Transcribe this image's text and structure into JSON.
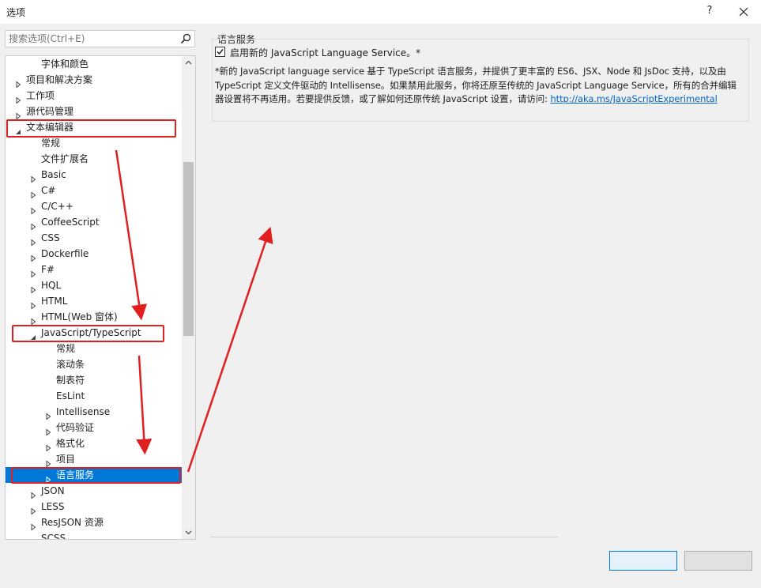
{
  "window": {
    "title": "选项",
    "help_label": "?"
  },
  "search": {
    "placeholder": "搜索选项(Ctrl+E)"
  },
  "tree": {
    "items": [
      {
        "label": "字体和颜色",
        "level": 2,
        "expander": "none"
      },
      {
        "label": "项目和解决方案",
        "level": 1,
        "expander": "collapsed"
      },
      {
        "label": "工作项",
        "level": 1,
        "expander": "collapsed"
      },
      {
        "label": "源代码管理",
        "level": 1,
        "expander": "collapsed"
      },
      {
        "label": "文本编辑器",
        "level": 1,
        "expander": "expanded"
      },
      {
        "label": "常规",
        "level": 2,
        "expander": "none"
      },
      {
        "label": "文件扩展名",
        "level": 2,
        "expander": "none"
      },
      {
        "label": "Basic",
        "level": 2,
        "expander": "collapsed"
      },
      {
        "label": "C#",
        "level": 2,
        "expander": "collapsed"
      },
      {
        "label": "C/C++",
        "level": 2,
        "expander": "collapsed"
      },
      {
        "label": "CoffeeScript",
        "level": 2,
        "expander": "collapsed"
      },
      {
        "label": "CSS",
        "level": 2,
        "expander": "collapsed"
      },
      {
        "label": "Dockerfile",
        "level": 2,
        "expander": "collapsed"
      },
      {
        "label": "F#",
        "level": 2,
        "expander": "collapsed"
      },
      {
        "label": "HQL",
        "level": 2,
        "expander": "collapsed"
      },
      {
        "label": "HTML",
        "level": 2,
        "expander": "collapsed"
      },
      {
        "label": "HTML(Web 窗体)",
        "level": 2,
        "expander": "collapsed"
      },
      {
        "label": "JavaScript/TypeScript",
        "level": 2,
        "expander": "expanded"
      },
      {
        "label": "常规",
        "level": 3,
        "expander": "none"
      },
      {
        "label": "滚动条",
        "level": 3,
        "expander": "none"
      },
      {
        "label": "制表符",
        "level": 3,
        "expander": "none"
      },
      {
        "label": "EsLint",
        "level": 3,
        "expander": "none"
      },
      {
        "label": "Intellisense",
        "level": 3,
        "expander": "collapsed"
      },
      {
        "label": "代码验证",
        "level": 3,
        "expander": "collapsed"
      },
      {
        "label": "格式化",
        "level": 3,
        "expander": "collapsed"
      },
      {
        "label": "项目",
        "level": 3,
        "expander": "collapsed"
      },
      {
        "label": "语言服务",
        "level": 3,
        "expander": "collapsed",
        "selected": true
      },
      {
        "label": "JSON",
        "level": 2,
        "expander": "collapsed"
      },
      {
        "label": "LESS",
        "level": 2,
        "expander": "collapsed"
      },
      {
        "label": "ResJSON 资源",
        "level": 2,
        "expander": "collapsed"
      },
      {
        "label": "SCSS",
        "level": 2,
        "expander": "collapsed"
      }
    ]
  },
  "panel": {
    "section_title": "语言服务",
    "checkbox_label": "启用新的 JavaScript Language Service。*",
    "checkbox_checked": true,
    "description": "*新的 JavaScript language service 基于 TypeScript 语言服务，并提供了更丰富的 ES6、JSX、Node 和 JsDoc 支持，以及由 TypeScript 定义文件驱动的 Intellisense。如果禁用此服务，你将还原至传统的 JavaScript Language Service，所有的合并编辑器设置将不再适用。若要提供反馈，或了解如何还原传统 JavaScript 设置，请访问: ",
    "link_text": "http://aka.ms/JavaScriptExperimental"
  },
  "buttons": {
    "ok_label": "",
    "cancel_label": ""
  },
  "colors": {
    "selection": "#0078d7",
    "annotation": "#e02020",
    "link": "#0066cc"
  }
}
